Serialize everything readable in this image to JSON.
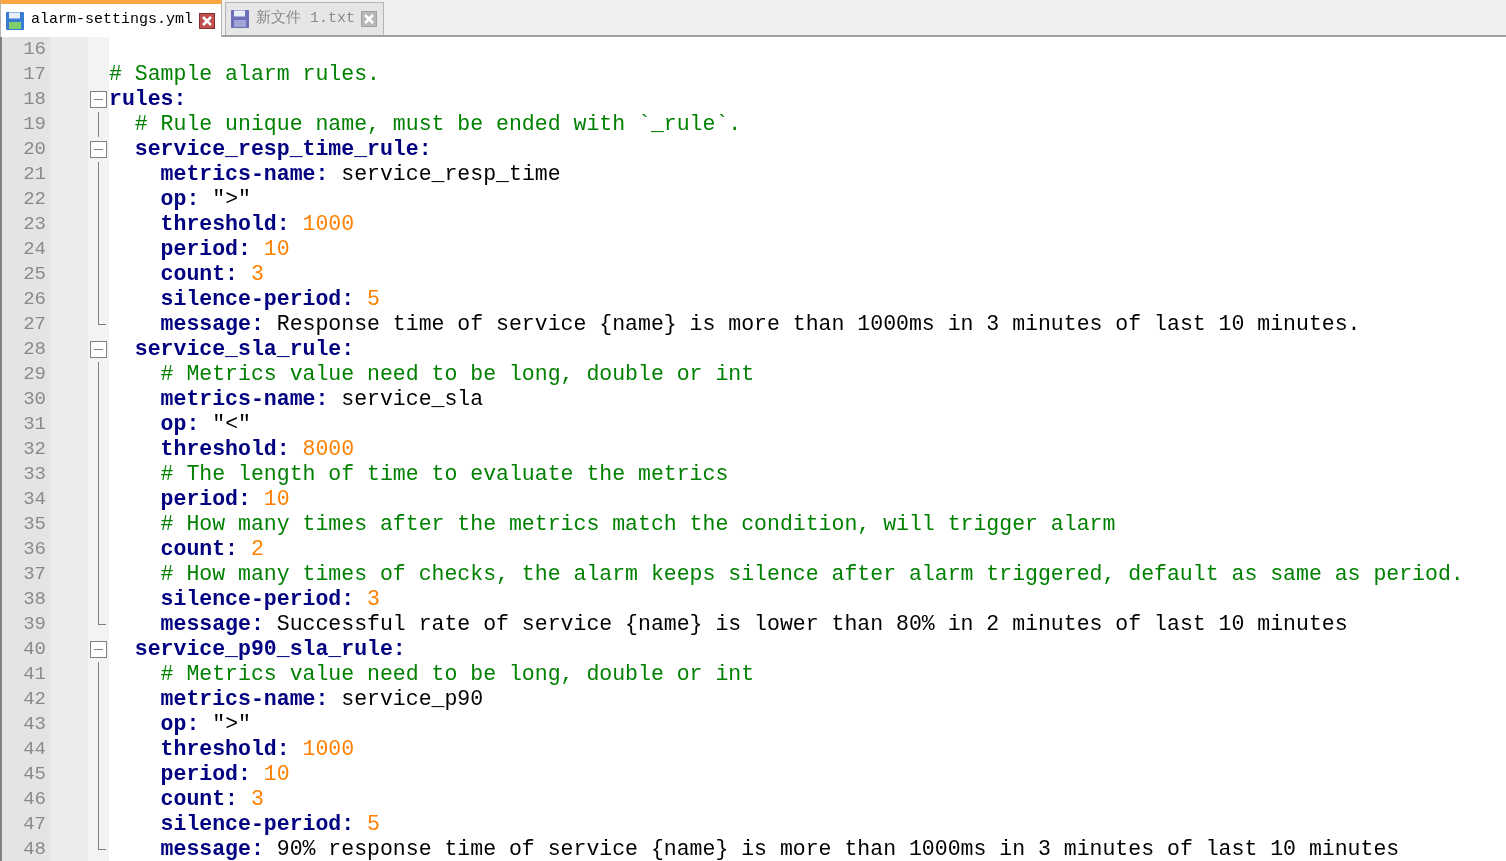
{
  "tabs": [
    {
      "label": "alarm-settings.yml",
      "selected": true
    },
    {
      "label": "新文件 1.txt",
      "selected": false
    }
  ],
  "lines": [
    {
      "number": "16",
      "kind": "plain"
    },
    {
      "number": "17",
      "kind": "plain",
      "tokens": [
        {
          "kind": "comment",
          "text": "# Sample alarm rules."
        }
      ]
    },
    {
      "number": "18",
      "kind": "header",
      "tokens": [
        {
          "kind": "key",
          "text": "rules:"
        }
      ]
    },
    {
      "number": "19",
      "kind": "inner",
      "tokens": [
        {
          "kind": "comment",
          "text": "  # Rule unique name, must be ended with `_rule`."
        }
      ]
    },
    {
      "number": "20",
      "kind": "header",
      "tokens": [
        {
          "kind": "key",
          "text": "  service_resp_time_rule:"
        }
      ]
    },
    {
      "number": "21",
      "kind": "inner",
      "tokens": [
        {
          "kind": "key",
          "text": "    metrics-name:"
        },
        {
          "kind": "text",
          "text": " service_resp_time"
        }
      ]
    },
    {
      "number": "22",
      "kind": "inner",
      "tokens": [
        {
          "kind": "key",
          "text": "    op:"
        },
        {
          "kind": "text",
          "text": " \">\""
        }
      ]
    },
    {
      "number": "23",
      "kind": "inner",
      "tokens": [
        {
          "kind": "key",
          "text": "    threshold:"
        },
        {
          "kind": "number",
          "text": " 1000"
        }
      ]
    },
    {
      "number": "24",
      "kind": "inner",
      "tokens": [
        {
          "kind": "key",
          "text": "    period:"
        },
        {
          "kind": "number",
          "text": " 10"
        }
      ]
    },
    {
      "number": "25",
      "kind": "inner",
      "tokens": [
        {
          "kind": "key",
          "text": "    count:"
        },
        {
          "kind": "number",
          "text": " 3"
        }
      ]
    },
    {
      "number": "26",
      "kind": "inner",
      "tokens": [
        {
          "kind": "key",
          "text": "    silence-period:"
        },
        {
          "kind": "number",
          "text": " 5"
        }
      ]
    },
    {
      "number": "27",
      "kind": "last",
      "tokens": [
        {
          "kind": "key",
          "text": "    message:"
        },
        {
          "kind": "text",
          "text": " Response time of service {name} is more than 1000ms in 3 minutes of last 10 minutes."
        }
      ]
    },
    {
      "number": "28",
      "kind": "header",
      "tokens": [
        {
          "kind": "key",
          "text": "  service_sla_rule:"
        }
      ]
    },
    {
      "number": "29",
      "kind": "inner",
      "tokens": [
        {
          "kind": "comment",
          "text": "    # Metrics value need to be long, double or int"
        }
      ]
    },
    {
      "number": "30",
      "kind": "inner",
      "tokens": [
        {
          "kind": "key",
          "text": "    metrics-name:"
        },
        {
          "kind": "text",
          "text": " service_sla"
        }
      ]
    },
    {
      "number": "31",
      "kind": "inner",
      "tokens": [
        {
          "kind": "key",
          "text": "    op:"
        },
        {
          "kind": "text",
          "text": " \"<\""
        }
      ]
    },
    {
      "number": "32",
      "kind": "inner",
      "tokens": [
        {
          "kind": "key",
          "text": "    threshold:"
        },
        {
          "kind": "number",
          "text": " 8000"
        }
      ]
    },
    {
      "number": "33",
      "kind": "inner",
      "tokens": [
        {
          "kind": "comment",
          "text": "    # The length of time to evaluate the metrics"
        }
      ]
    },
    {
      "number": "34",
      "kind": "inner",
      "tokens": [
        {
          "kind": "key",
          "text": "    period:"
        },
        {
          "kind": "number",
          "text": " 10"
        }
      ]
    },
    {
      "number": "35",
      "kind": "inner",
      "tokens": [
        {
          "kind": "comment",
          "text": "    # How many times after the metrics match the condition, will trigger alarm"
        }
      ]
    },
    {
      "number": "36",
      "kind": "inner",
      "tokens": [
        {
          "kind": "key",
          "text": "    count:"
        },
        {
          "kind": "number",
          "text": " 2"
        }
      ]
    },
    {
      "number": "37",
      "kind": "inner",
      "tokens": [
        {
          "kind": "comment",
          "text": "    # How many times of checks, the alarm keeps silence after alarm triggered, default as same as period."
        }
      ]
    },
    {
      "number": "38",
      "kind": "inner",
      "tokens": [
        {
          "kind": "key",
          "text": "    silence-period:"
        },
        {
          "kind": "number",
          "text": " 3"
        }
      ]
    },
    {
      "number": "39",
      "kind": "last",
      "tokens": [
        {
          "kind": "key",
          "text": "    message:"
        },
        {
          "kind": "text",
          "text": " Successful rate of service {name} is lower than 80% in 2 minutes of last 10 minutes"
        }
      ]
    },
    {
      "number": "40",
      "kind": "header",
      "tokens": [
        {
          "kind": "key",
          "text": "  service_p90_sla_rule:"
        }
      ]
    },
    {
      "number": "41",
      "kind": "inner",
      "tokens": [
        {
          "kind": "comment",
          "text": "    # Metrics value need to be long, double or int"
        }
      ]
    },
    {
      "number": "42",
      "kind": "inner",
      "tokens": [
        {
          "kind": "key",
          "text": "    metrics-name:"
        },
        {
          "kind": "text",
          "text": " service_p90"
        }
      ]
    },
    {
      "number": "43",
      "kind": "inner",
      "tokens": [
        {
          "kind": "key",
          "text": "    op:"
        },
        {
          "kind": "text",
          "text": " \">\""
        }
      ]
    },
    {
      "number": "44",
      "kind": "inner",
      "tokens": [
        {
          "kind": "key",
          "text": "    threshold:"
        },
        {
          "kind": "number",
          "text": " 1000"
        }
      ]
    },
    {
      "number": "45",
      "kind": "inner",
      "tokens": [
        {
          "kind": "key",
          "text": "    period:"
        },
        {
          "kind": "number",
          "text": " 10"
        }
      ]
    },
    {
      "number": "46",
      "kind": "inner",
      "tokens": [
        {
          "kind": "key",
          "text": "    count:"
        },
        {
          "kind": "number",
          "text": " 3"
        }
      ]
    },
    {
      "number": "47",
      "kind": "inner",
      "tokens": [
        {
          "kind": "key",
          "text": "    silence-period:"
        },
        {
          "kind": "number",
          "text": " 5"
        }
      ]
    },
    {
      "number": "48",
      "kind": "last",
      "tokens": [
        {
          "kind": "key",
          "text": "    message:"
        },
        {
          "kind": "text",
          "text": " 90% response time of service {name} is more than 1000ms in 3 minutes of last 10 minutes"
        }
      ]
    }
  ]
}
